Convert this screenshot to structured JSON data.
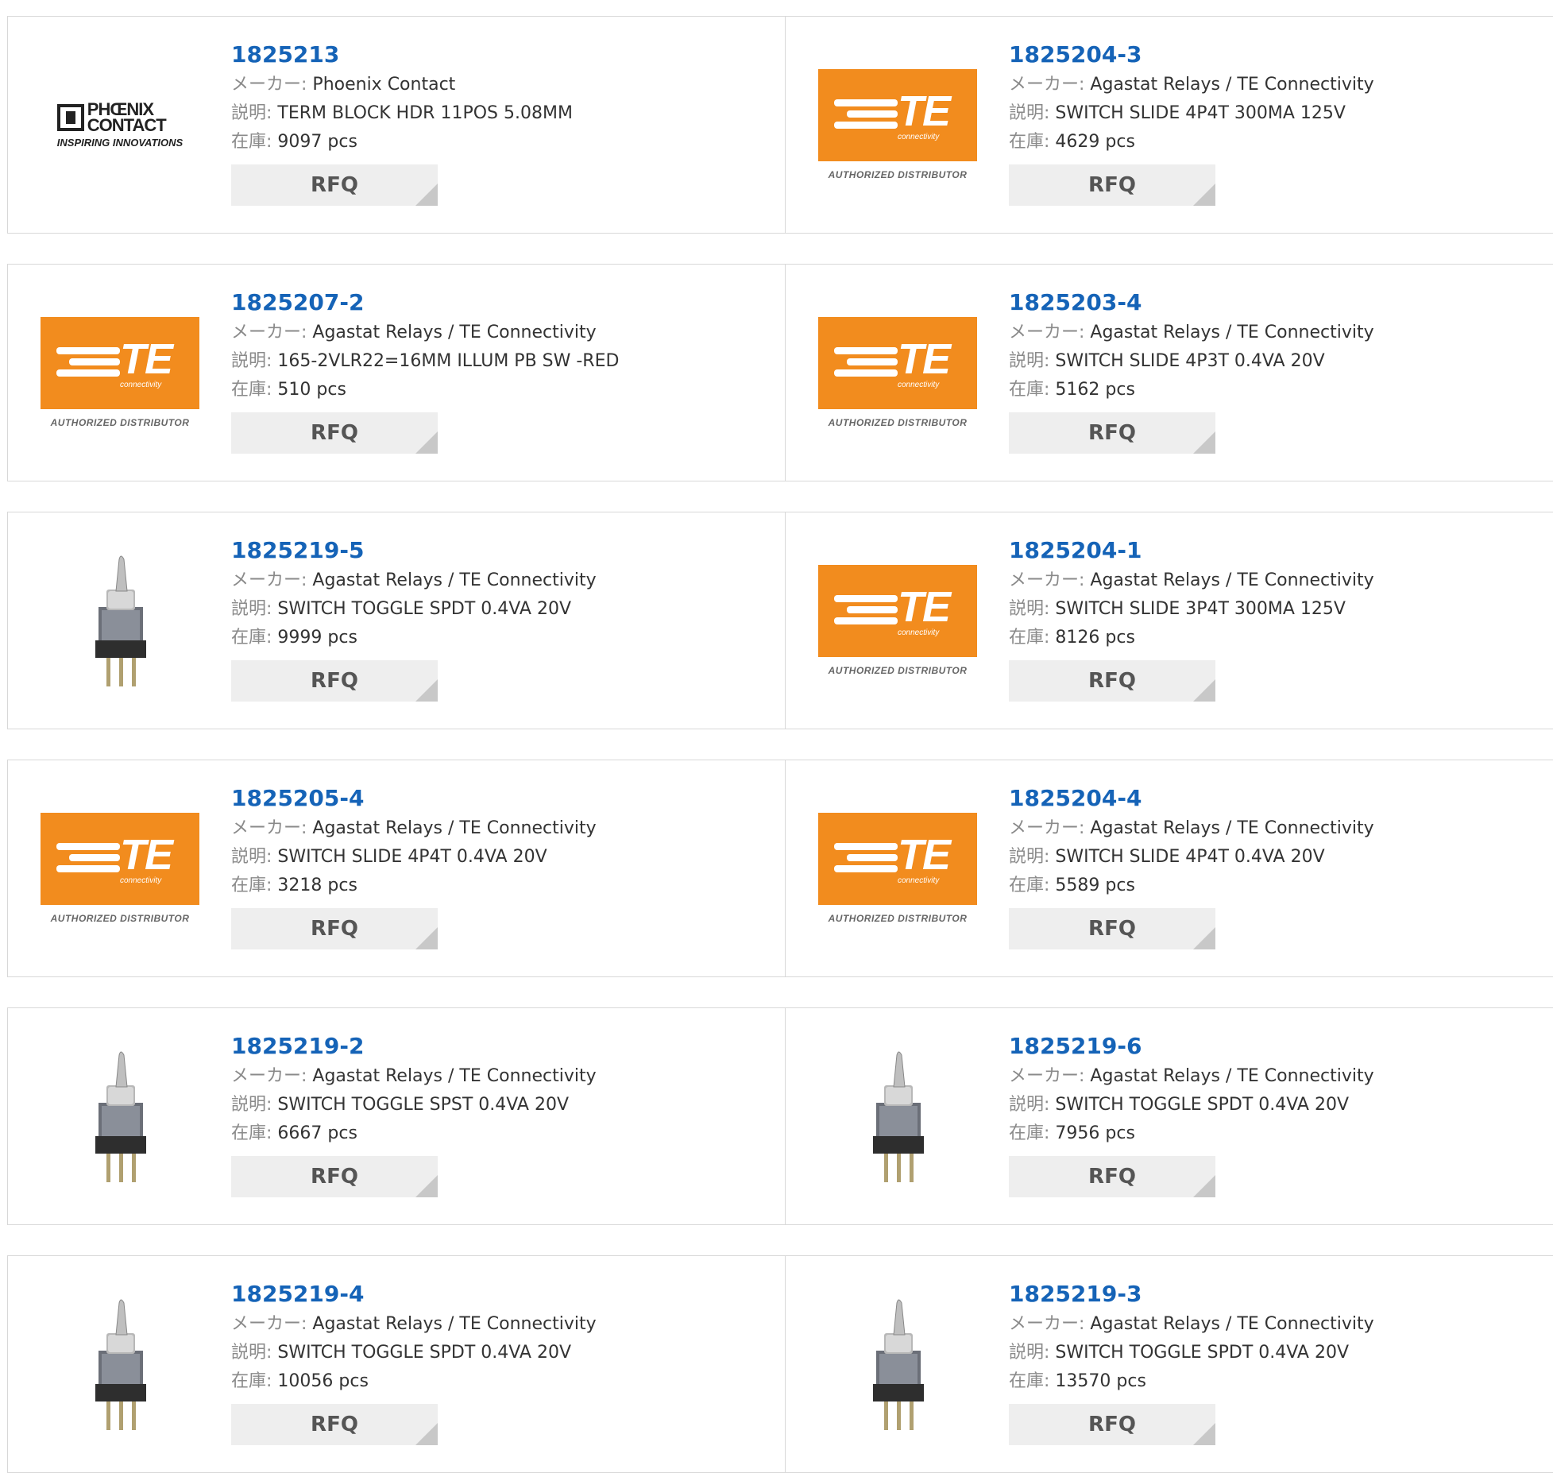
{
  "labels": {
    "maker": "メーカー:",
    "desc": "説明:",
    "stock": "在庫:",
    "rfq": "RFQ"
  },
  "logos": {
    "te_text": "TE",
    "te_sub": "connectivity",
    "te_auth": "AUTHORIZED DISTRIBUTOR",
    "phoenix_line1": "PHŒNIX",
    "phoenix_line2": "CONTACT",
    "phoenix_tag": "INSPIRING INNOVATIONS"
  },
  "products": [
    {
      "part": "1825213",
      "maker": "Phoenix Contact",
      "desc": "TERM BLOCK HDR 11POS 5.08MM",
      "stock": "9097 pcs",
      "image": "phoenix-logo"
    },
    {
      "part": "1825204-3",
      "maker": "Agastat Relays / TE Connectivity",
      "desc": "SWITCH SLIDE 4P4T 300MA 125V",
      "stock": "4629 pcs",
      "image": "te-logo"
    },
    {
      "part": "1825207-2",
      "maker": "Agastat Relays / TE Connectivity",
      "desc": "165-2VLR22=16MM ILLUM PB SW -RED",
      "stock": "510 pcs",
      "image": "te-logo"
    },
    {
      "part": "1825203-4",
      "maker": "Agastat Relays / TE Connectivity",
      "desc": "SWITCH SLIDE 4P3T 0.4VA 20V",
      "stock": "5162 pcs",
      "image": "te-logo"
    },
    {
      "part": "1825219-5",
      "maker": "Agastat Relays / TE Connectivity",
      "desc": "SWITCH TOGGLE SPDT 0.4VA 20V",
      "stock": "9999 pcs",
      "image": "toggle-switch-photo"
    },
    {
      "part": "1825204-1",
      "maker": "Agastat Relays / TE Connectivity",
      "desc": "SWITCH SLIDE 3P4T 300MA 125V",
      "stock": "8126 pcs",
      "image": "te-logo"
    },
    {
      "part": "1825205-4",
      "maker": "Agastat Relays / TE Connectivity",
      "desc": "SWITCH SLIDE 4P4T 0.4VA 20V",
      "stock": "3218 pcs",
      "image": "te-logo"
    },
    {
      "part": "1825204-4",
      "maker": "Agastat Relays / TE Connectivity",
      "desc": "SWITCH SLIDE 4P4T 0.4VA 20V",
      "stock": "5589 pcs",
      "image": "te-logo"
    },
    {
      "part": "1825219-2",
      "maker": "Agastat Relays / TE Connectivity",
      "desc": "SWITCH TOGGLE SPST 0.4VA 20V",
      "stock": "6667 pcs",
      "image": "toggle-switch-photo"
    },
    {
      "part": "1825219-6",
      "maker": "Agastat Relays / TE Connectivity",
      "desc": "SWITCH TOGGLE SPDT 0.4VA 20V",
      "stock": "7956 pcs",
      "image": "toggle-switch-photo"
    },
    {
      "part": "1825219-4",
      "maker": "Agastat Relays / TE Connectivity",
      "desc": "SWITCH TOGGLE SPDT 0.4VA 20V",
      "stock": "10056 pcs",
      "image": "toggle-switch-photo"
    },
    {
      "part": "1825219-3",
      "maker": "Agastat Relays / TE Connectivity",
      "desc": "SWITCH TOGGLE SPDT 0.4VA 20V",
      "stock": "13570 pcs",
      "image": "toggle-switch-photo"
    }
  ]
}
